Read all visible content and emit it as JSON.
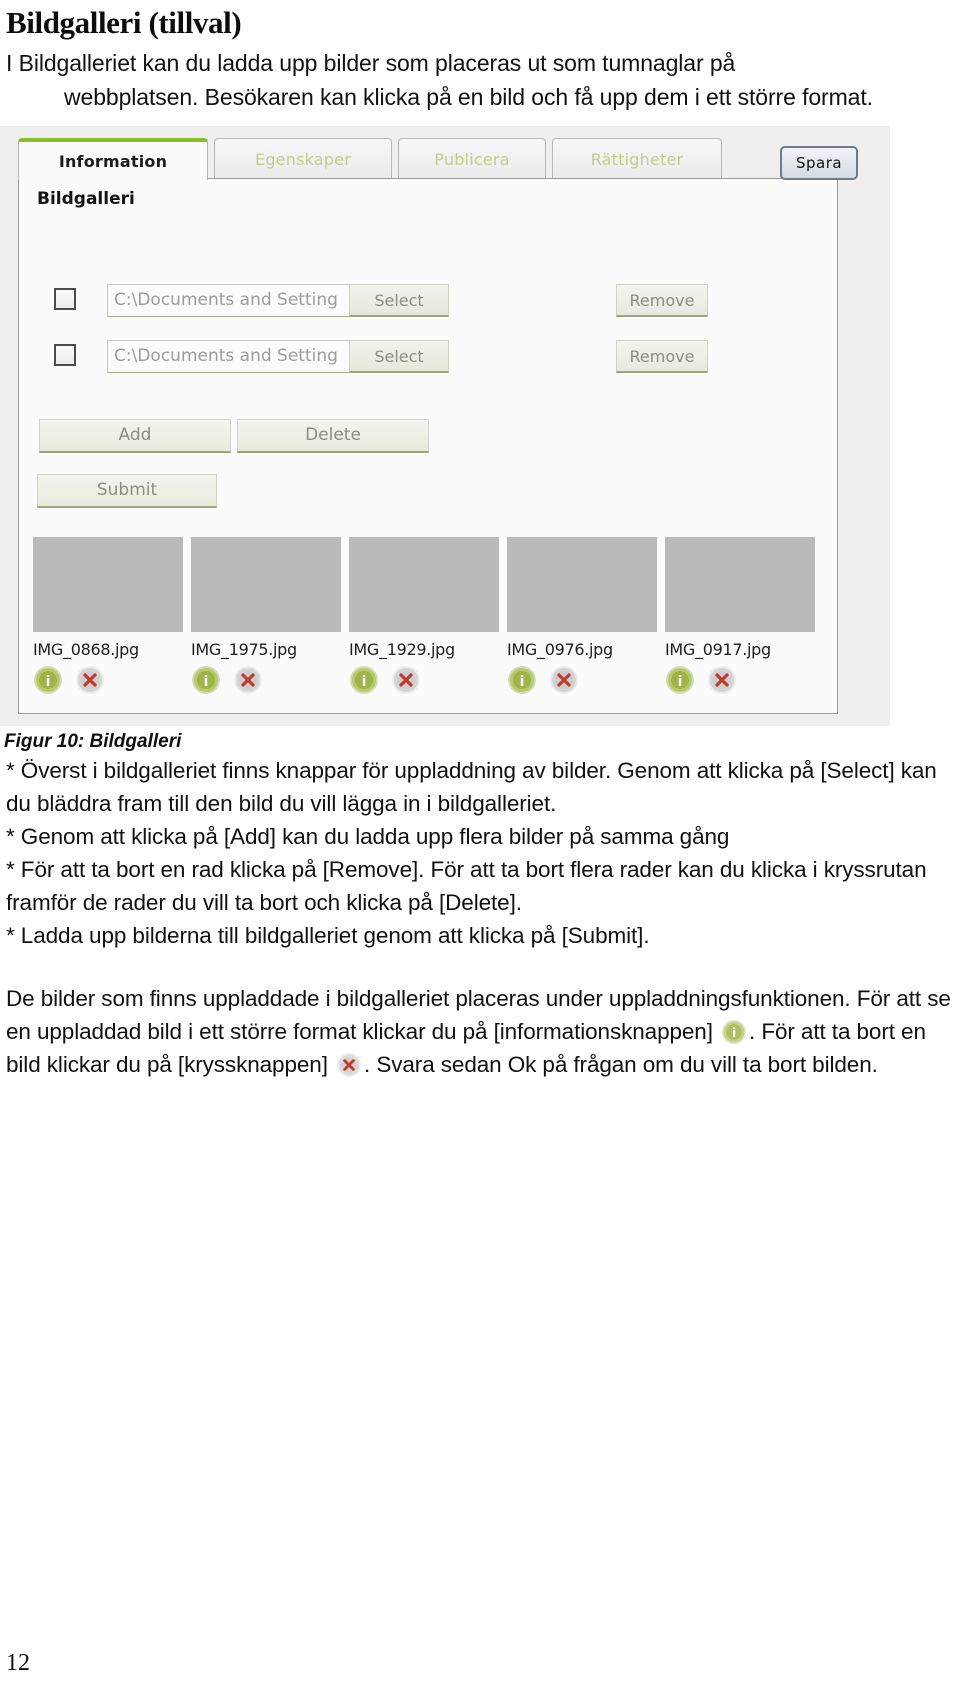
{
  "document": {
    "title": "Bildgalleri (tillval)",
    "intro_line1": "I Bildgalleriet kan du ladda upp bilder som placeras ut som tumnaglar på",
    "intro_line2": "webbplatsen. Besökaren kan klicka på en bild och få upp dem i ett större format.",
    "figure_caption": "Figur 10: Bildgalleri",
    "page_number": "12"
  },
  "screenshot": {
    "tabs": [
      {
        "label": "Information",
        "active": true
      },
      {
        "label": "Egenskaper",
        "active": false
      },
      {
        "label": "Publicera",
        "active": false
      },
      {
        "label": "Rättigheter",
        "active": false
      }
    ],
    "save_button": "Spara",
    "panel_title": "Bildgalleri",
    "rows": [
      {
        "path_value": "C:\\Documents and Setting",
        "select_label": "Select",
        "remove_label": "Remove",
        "checked": false
      },
      {
        "path_value": "C:\\Documents and Setting",
        "select_label": "Select",
        "remove_label": "Remove",
        "checked": false
      }
    ],
    "actions": {
      "add_label": "Add",
      "delete_label": "Delete",
      "submit_label": "Submit"
    },
    "thumbnails": [
      {
        "filename": "IMG_0868.jpg"
      },
      {
        "filename": "IMG_1975.jpg"
      },
      {
        "filename": "IMG_1929.jpg"
      },
      {
        "filename": "IMG_0976.jpg"
      },
      {
        "filename": "IMG_0917.jpg"
      }
    ],
    "icon_names": {
      "info": "info-icon",
      "delete": "delete-cross-icon"
    },
    "colors": {
      "active_tab_accent": "#8cbf26",
      "inactive_tab_text": "#c3d08c",
      "thumb_placeholder": "#bcbcbc",
      "info_icon_green": "#a8bf4a",
      "delete_icon_red": "#c0392b"
    }
  },
  "body": {
    "p1_line1": "* Överst i bildgalleriet finns knappar för uppladdning av bilder. Genom att klicka på",
    "p1_line2": "[Select] kan du bläddra fram till den bild du vill lägga in i bildgalleriet.",
    "p2": "* Genom att klicka på [Add] kan du ladda upp flera bilder på samma gång",
    "p3_line1": "* För att ta bort en rad klicka på [Remove]. För att ta bort flera rader kan du klicka i",
    "p3_line2": "kryssrutan framför de rader du vill ta bort och klicka på [Delete].",
    "p4": "* Ladda upp bilderna till bildgalleriet genom att klicka på [Submit].",
    "p5_line1": "De bilder som finns uppladdade i bildgalleriet placeras under",
    "p5_line2": "uppladdningsfunktionen. För att se en uppladdad bild i ett större format klickar du",
    "p5_line3a": "på [informationsknappen]",
    "p5_line3b": ". För att ta bort en bild klickar du på [kryssknappen]",
    "p5_line4": ". Svara sedan Ok på frågan om du vill ta bort bilden."
  }
}
